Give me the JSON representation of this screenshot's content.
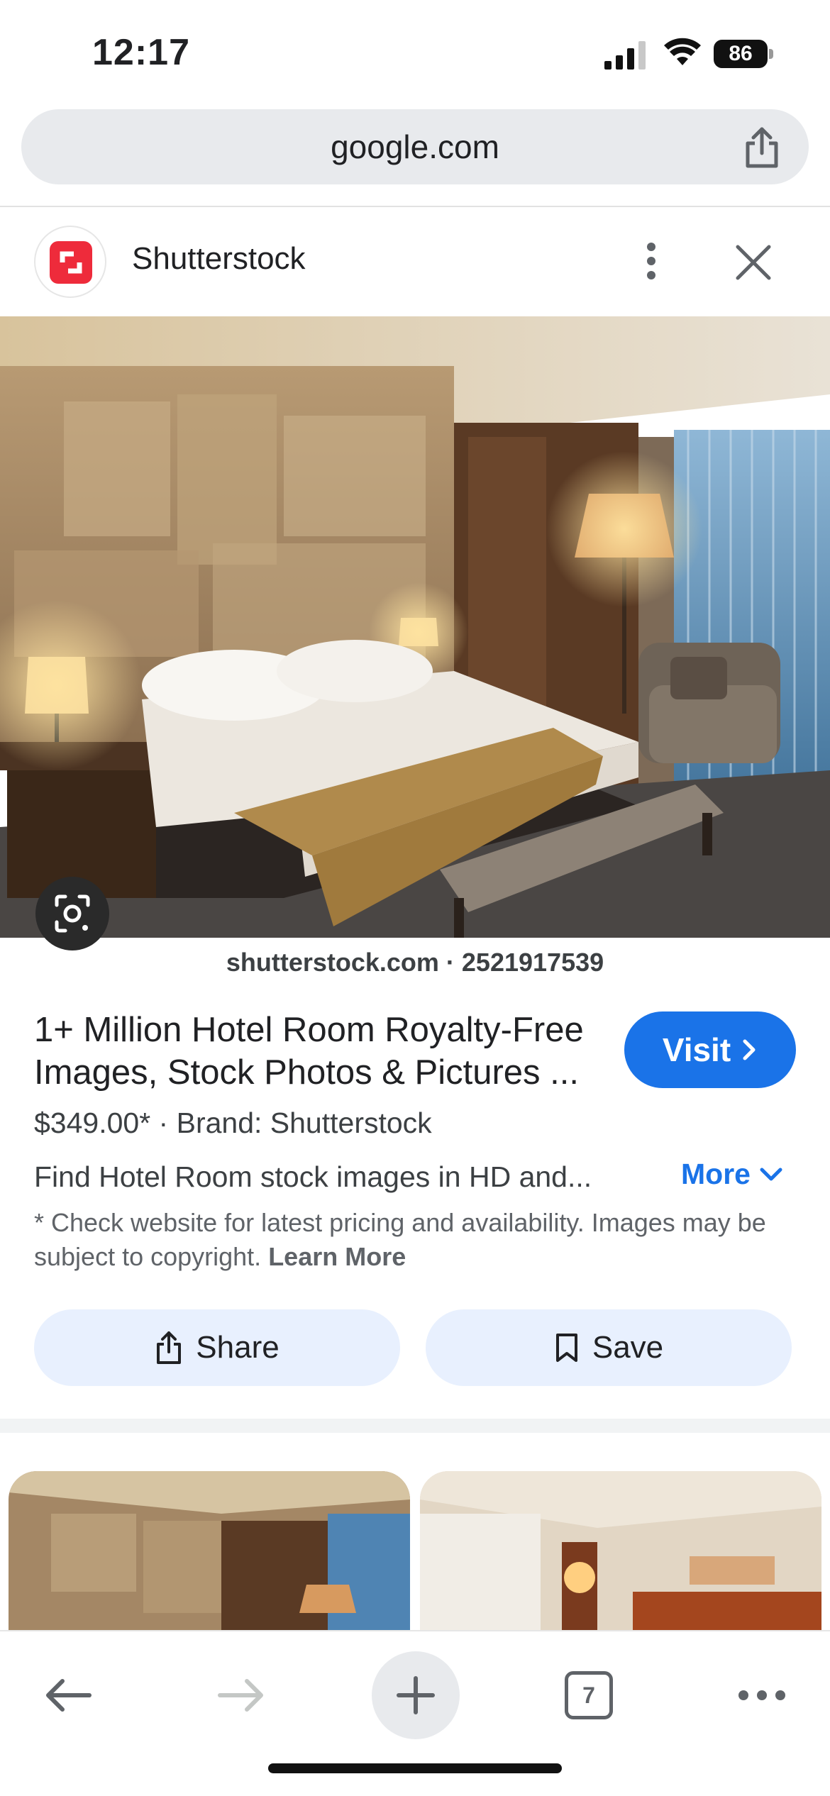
{
  "status_bar": {
    "time": "12:17",
    "battery": "86"
  },
  "browser": {
    "url": "google.com",
    "tab_count": "7"
  },
  "source": {
    "name": "Shutterstock",
    "logo_color": "#ee2b3b"
  },
  "image": {
    "caption": "shutterstock.com · 2521917539"
  },
  "result": {
    "title": "1+ Million Hotel Room Royalty-Free Images, Stock Photos & Pictures ...",
    "visit_label": "Visit",
    "price_line": "$349.00*  ·  Brand: Shutterstock",
    "description": "Find Hotel Room stock images in HD and...",
    "more_label": "More",
    "disclaimer": "* Check website for latest pricing and availability. Images may be subject to copyright.",
    "learn_more": "Learn More"
  },
  "actions": {
    "share_label": "Share",
    "save_label": "Save"
  },
  "icons": {
    "url_share": "share-icon",
    "kebab": "more-vert-icon",
    "close": "close-icon",
    "lens": "lens-icon",
    "back": "back-arrow-icon",
    "forward": "forward-arrow-icon",
    "new_tab": "plus-icon",
    "menu": "more-horiz-icon"
  },
  "colors": {
    "accent": "#1a73e8",
    "button_bg": "#e8f0fe"
  }
}
